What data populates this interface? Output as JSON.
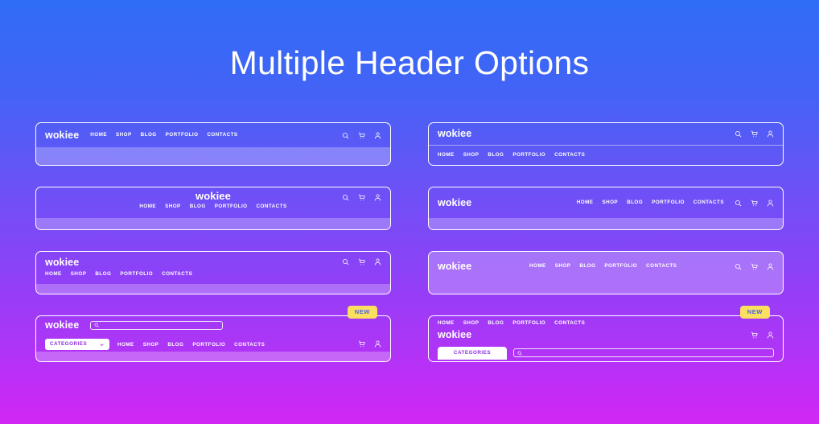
{
  "page": {
    "title": "Multiple Header Options",
    "background_top_color": "#2f6cf6",
    "background_bottom_color": "#d226f5"
  },
  "brand": {
    "logo": "wokiee"
  },
  "nav_labels": {
    "home": "HOME",
    "shop": "SHOP",
    "blog": "BLOG",
    "portfolio": "PORTFOLIO",
    "contacts": "CONTACTS"
  },
  "icons": {
    "search": "search-icon",
    "cart": "cart-icon",
    "user": "user-icon",
    "chevron_down": "chevron-down-icon"
  },
  "controls": {
    "categories_label": "CATEGORIES",
    "search_placeholder": "",
    "search_value": "",
    "new_badge": "NEW",
    "new_badge_bg": "#fbdf5f",
    "new_badge_text_color": "#4a63e8"
  },
  "headers": [
    {
      "id": "header-1",
      "variant": "logo-nav-left-icons-right",
      "logo": "wokiee",
      "nav": [
        "HOME",
        "SHOP",
        "BLOG",
        "PORTFOLIO",
        "CONTACTS"
      ],
      "icons": [
        "search-icon",
        "cart-icon",
        "user-icon"
      ],
      "has_badge": false
    },
    {
      "id": "header-2",
      "variant": "logo-row-divider-nav-row",
      "logo": "wokiee",
      "nav": [
        "HOME",
        "SHOP",
        "BLOG",
        "PORTFOLIO",
        "CONTACTS"
      ],
      "icons": [
        "search-icon",
        "cart-icon",
        "user-icon"
      ],
      "has_badge": false
    },
    {
      "id": "header-3",
      "variant": "centered-logo-centered-nav",
      "logo": "wokiee",
      "nav": [
        "HOME",
        "SHOP",
        "BLOG",
        "PORTFOLIO",
        "CONTACTS"
      ],
      "icons": [
        "search-icon",
        "cart-icon",
        "user-icon"
      ],
      "has_badge": false
    },
    {
      "id": "header-4",
      "variant": "logo-left-nav-right",
      "logo": "wokiee",
      "nav": [
        "HOME",
        "SHOP",
        "BLOG",
        "PORTFOLIO",
        "CONTACTS"
      ],
      "icons": [
        "search-icon",
        "cart-icon",
        "user-icon"
      ],
      "has_badge": false
    },
    {
      "id": "header-5",
      "variant": "logo-above-nav-left",
      "logo": "wokiee",
      "nav": [
        "HOME",
        "SHOP",
        "BLOG",
        "PORTFOLIO",
        "CONTACTS"
      ],
      "icons": [
        "search-icon",
        "cart-icon",
        "user-icon"
      ],
      "has_badge": false
    },
    {
      "id": "header-6",
      "variant": "logo-left-nav-center-light",
      "logo": "wokiee",
      "nav": [
        "HOME",
        "SHOP",
        "BLOG",
        "PORTFOLIO",
        "CONTACTS"
      ],
      "icons": [
        "search-icon",
        "cart-icon",
        "user-icon"
      ],
      "has_badge": false
    },
    {
      "id": "header-7",
      "variant": "logo-search-categories-nav",
      "logo": "wokiee",
      "nav": [
        "HOME",
        "SHOP",
        "BLOG",
        "PORTFOLIO",
        "CONTACTS"
      ],
      "icons": [
        "cart-icon",
        "user-icon"
      ],
      "categories_label": "CATEGORIES",
      "has_search": true,
      "has_badge": true,
      "badge": "NEW"
    },
    {
      "id": "header-8",
      "variant": "nav-top-logo-categories-search",
      "logo": "wokiee",
      "nav": [
        "HOME",
        "SHOP",
        "BLOG",
        "PORTFOLIO",
        "CONTACTS"
      ],
      "icons": [
        "cart-icon",
        "user-icon"
      ],
      "categories_label": "CATEGORIES",
      "has_search": true,
      "has_badge": true,
      "badge": "NEW"
    }
  ]
}
